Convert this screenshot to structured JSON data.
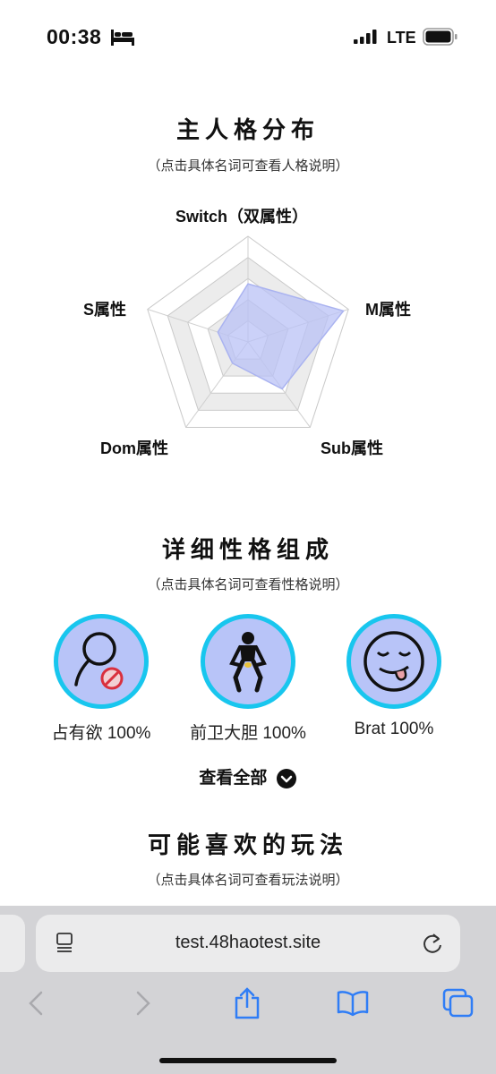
{
  "status_bar": {
    "time": "00:38",
    "carrier": "LTE"
  },
  "personality": {
    "title": "主人格分布",
    "subtitle": "（点击具体名词可查看人格说明）",
    "radar": {
      "axes": [
        "Switch（双属性）",
        "M属性",
        "Sub属性",
        "Dom属性",
        "S属性"
      ],
      "values": [
        0.55,
        0.95,
        0.55,
        0.25,
        0.3
      ],
      "fill_color": "#b9c1f6"
    }
  },
  "traits_section": {
    "title": "详细性格组成",
    "subtitle": "（点击具体名词可查看性格说明）",
    "items": [
      {
        "label": "占有欲 100%",
        "icon": "magnifier-no-icon"
      },
      {
        "label": "前卫大胆 100%",
        "icon": "figure-icon"
      },
      {
        "label": "Brat 100%",
        "icon": "tongue-face-icon"
      }
    ],
    "view_all": "查看全部",
    "accent_color": "#18c6ee"
  },
  "play_section": {
    "title": "可能喜欢的玩法",
    "subtitle": "（点击具体名词可查看玩法说明）"
  },
  "browser": {
    "url": "test.48haotest.site"
  }
}
